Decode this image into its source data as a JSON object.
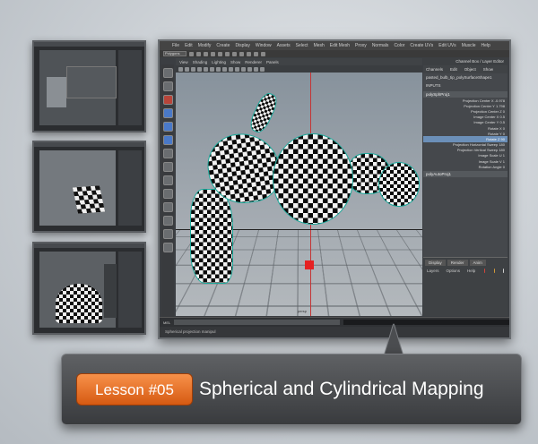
{
  "main_window": {
    "menu": [
      "File",
      "Edit",
      "Modify",
      "Create",
      "Display",
      "Window",
      "Assets",
      "Select",
      "Mesh",
      "Edit Mesh",
      "Proxy",
      "Normals",
      "Color",
      "Create UVs",
      "Edit UVs",
      "Muscle",
      "Help"
    ],
    "status_mode": "Polygons",
    "panel_menu": [
      "View",
      "Shading",
      "Lighting",
      "Show",
      "Renderer",
      "Panels"
    ],
    "viewport_label": "persp",
    "timeline_label": "MEL",
    "help_line": "Spherical projection manipul",
    "channel_box": {
      "header": "Channel Box / Layer Editor",
      "tabs": [
        "Channels",
        "Edit",
        "Object",
        "Show"
      ],
      "object_name": "pasted_bulb_tip_polySurfaceShape1",
      "object_sub": "INPUTS",
      "node": "polySphProj1",
      "attributes": [
        {
          "name": "Projection Center X",
          "value": "-0.978",
          "highlight": false
        },
        {
          "name": "Projection Center Y",
          "value": "1.798",
          "highlight": false
        },
        {
          "name": "Projection Center Z",
          "value": "0",
          "highlight": false
        },
        {
          "name": "Image Center X",
          "value": "0.5",
          "highlight": false
        },
        {
          "name": "Image Center Y",
          "value": "0.5",
          "highlight": false
        },
        {
          "name": "Rotate X",
          "value": "0",
          "highlight": false
        },
        {
          "name": "Rotate Y",
          "value": "0",
          "highlight": false
        },
        {
          "name": "Rotate Z",
          "value": "90",
          "highlight": true
        },
        {
          "name": "Projection Horizontal Sweep",
          "value": "180",
          "highlight": false
        },
        {
          "name": "Projection Vertical Sweep",
          "value": "180",
          "highlight": false
        },
        {
          "name": "Image Scale U",
          "value": "1",
          "highlight": false
        },
        {
          "name": "Image Scale V",
          "value": "1",
          "highlight": false
        },
        {
          "name": "Rotation Angle",
          "value": "0",
          "highlight": false
        }
      ],
      "node2": "polyAutoProj1"
    },
    "layer_tabs": [
      "Display",
      "Render",
      "Anim"
    ],
    "layer_menu": [
      "Layers",
      "Options",
      "Help"
    ]
  },
  "lesson": {
    "badge": "Lesson #05",
    "title": "Spherical and Cylindrical Mapping"
  },
  "colors": {
    "badge_orange": "#e8742a",
    "highlight_blue": "#6b8fb8",
    "manipulator_red": "#e52222"
  }
}
